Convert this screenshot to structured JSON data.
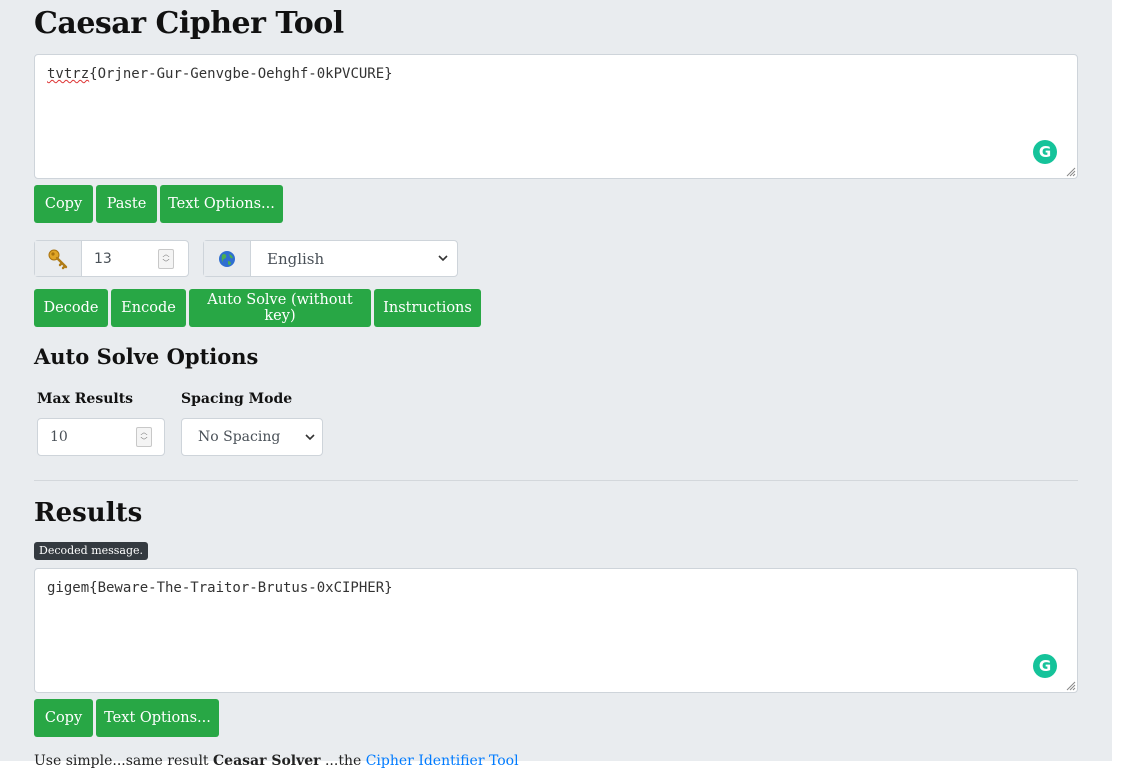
{
  "title": "Caesar Cipher Tool",
  "input": {
    "prefix_misspelled": "tvtrz",
    "rest": "{Orjner-Gur-Genvgbe-Oehghf-0kPVCURE}"
  },
  "input_buttons": {
    "copy": "Copy",
    "paste": "Paste",
    "text_options": "Text Options..."
  },
  "key": {
    "value": "13",
    "icon": "key-icon"
  },
  "language": {
    "selected": "English",
    "icon": "globe-icon"
  },
  "actions": {
    "decode": "Decode",
    "encode": "Encode",
    "auto_solve": "Auto Solve (without key)",
    "instructions": "Instructions"
  },
  "auto_solve": {
    "heading": "Auto Solve Options",
    "max_results_label": "Max Results",
    "max_results_value": "10",
    "spacing_label": "Spacing Mode",
    "spacing_selected": "No Spacing"
  },
  "results": {
    "heading": "Results",
    "badge": "Decoded message.",
    "output": "gigem{Beware-The-Traitor-Brutus-0xCIPHER}",
    "copy": "Copy",
    "text_options": "Text Options..."
  },
  "footer": {
    "part1": "Use simple...same result",
    "bold": "Ceasar Solver",
    "part2": "...the",
    "link": "Cipher Identifier Tool"
  },
  "colors": {
    "button": "#28a745",
    "background": "#e9ecef",
    "grammarly": "#15c39a"
  }
}
